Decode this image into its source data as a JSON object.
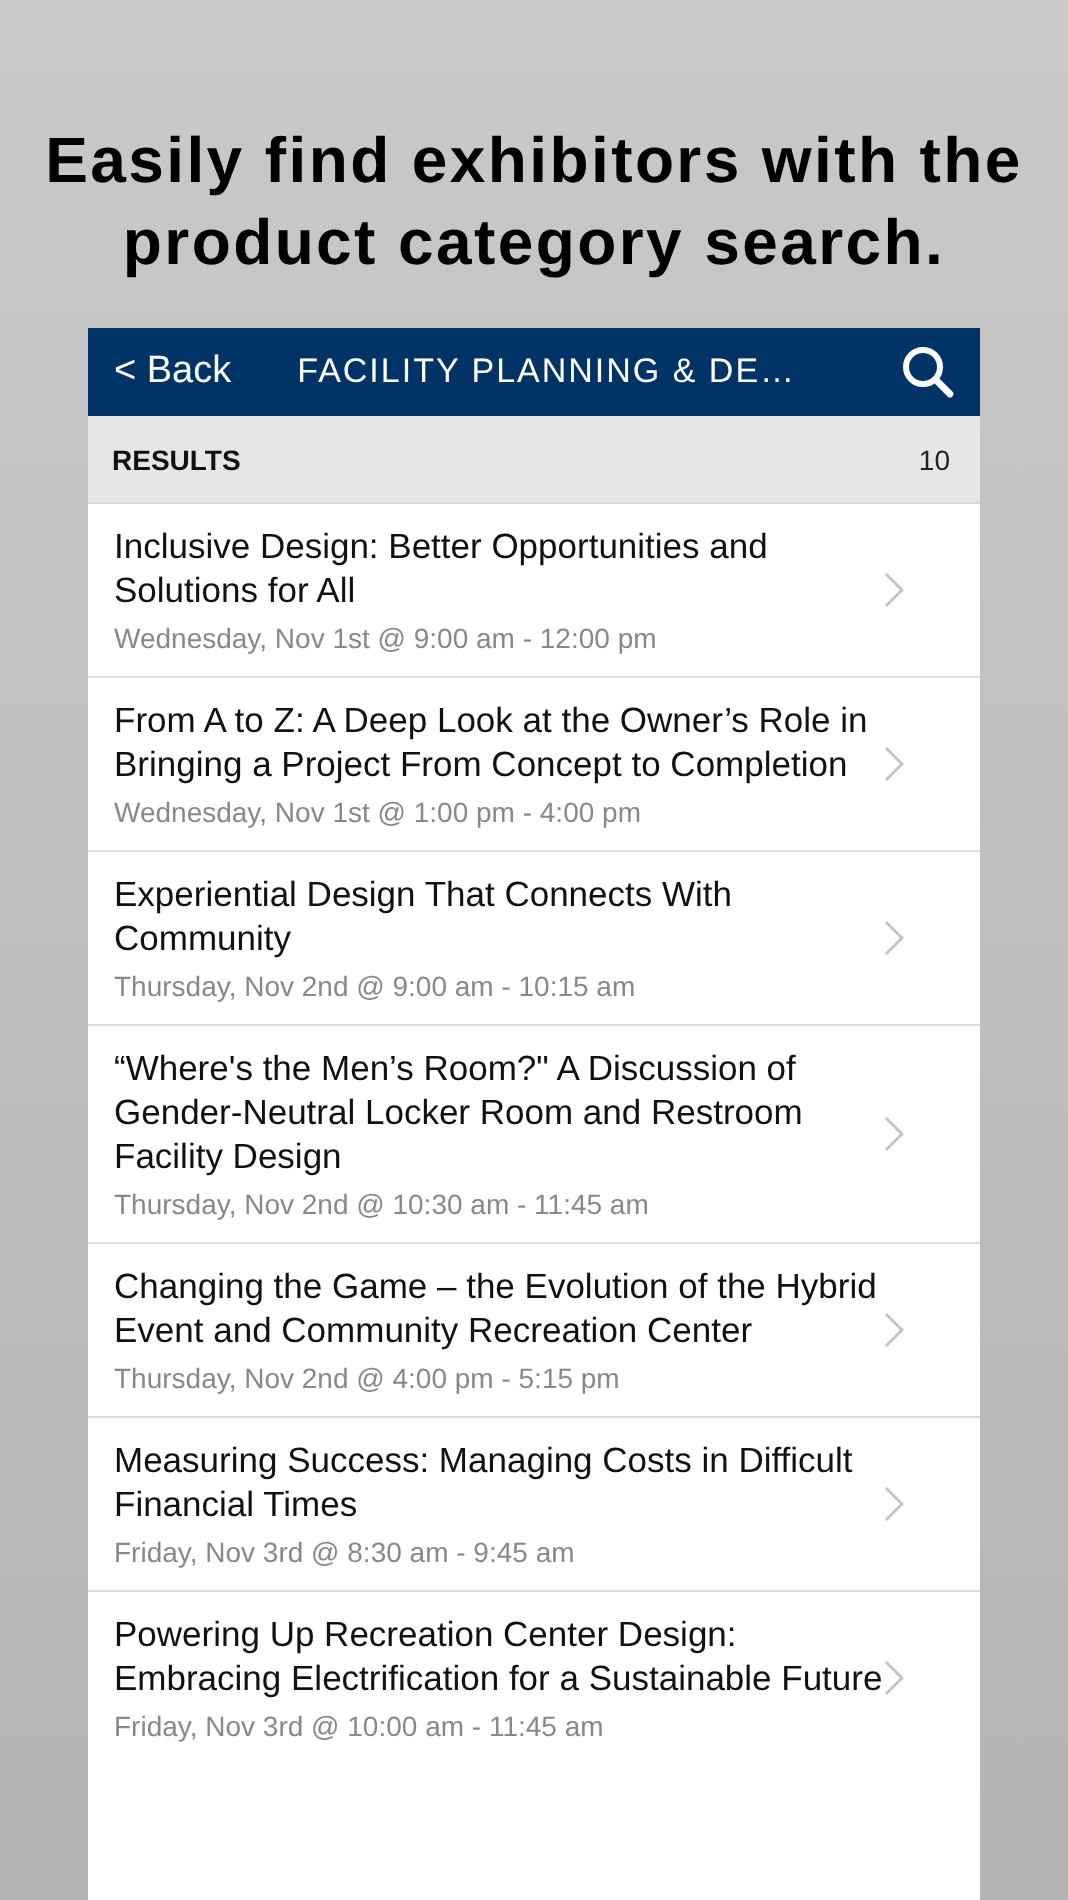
{
  "headline": "Easily find exhibitors with the product category search.",
  "nav": {
    "back": "< Back",
    "title": "FACILITY PLANNING & DE…"
  },
  "results": {
    "label": "RESULTS",
    "count": "10"
  },
  "sessions": [
    {
      "title": "Inclusive Design: Better Opportunities and Solutions for All",
      "time": "Wednesday, Nov 1st @ 9:00 am - 12:00 pm"
    },
    {
      "title": "From A to Z: A Deep Look at the Owner’s Role in Bringing a Project From Concept to Completion",
      "time": "Wednesday, Nov 1st @ 1:00 pm - 4:00 pm"
    },
    {
      "title": "Experiential Design That Connects With Community",
      "time": "Thursday, Nov 2nd @ 9:00 am - 10:15 am"
    },
    {
      "title": "“Where's the Men’s Room?\" A Discussion of Gender-Neutral Locker Room and Restroom Facility Design",
      "time": "Thursday, Nov 2nd @ 10:30 am - 11:45 am"
    },
    {
      "title": "Changing the Game – the Evolution of the Hybrid Event and Community Recreation Center",
      "time": "Thursday, Nov 2nd @ 4:00 pm - 5:15 pm"
    },
    {
      "title": "Measuring Success: Managing Costs in Difficult Financial Times",
      "time": "Friday, Nov 3rd @ 8:30 am - 9:45 am"
    },
    {
      "title": "Powering Up Recreation Center Design: Embracing Electrification for a Sustainable Future",
      "time": "Friday, Nov 3rd @ 10:00 am - 11:45 am"
    }
  ]
}
